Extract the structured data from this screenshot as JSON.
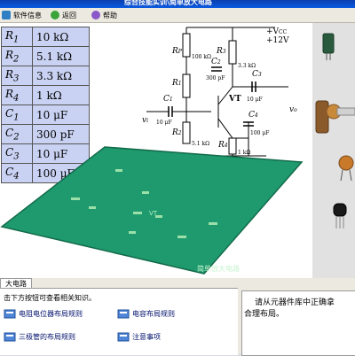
{
  "window": {
    "title": "综合技能实训\\简单放大电路"
  },
  "toolbar": {
    "info_label": "软件信息",
    "back_label": "返回",
    "help_label": "帮助"
  },
  "components": [
    {
      "symbol": "R",
      "sub": "1",
      "value": "10 kΩ"
    },
    {
      "symbol": "R",
      "sub": "2",
      "value": "5.1 kΩ"
    },
    {
      "symbol": "R",
      "sub": "3",
      "value": "3.3 kΩ"
    },
    {
      "symbol": "R",
      "sub": "4",
      "value": "1 kΩ"
    },
    {
      "symbol": "C",
      "sub": "1",
      "value": "10 μF"
    },
    {
      "symbol": "C",
      "sub": "2",
      "value": "300 pF"
    },
    {
      "symbol": "C",
      "sub": "3",
      "value": "10 μF"
    },
    {
      "symbol": "C",
      "sub": "4",
      "value": "100 μF"
    }
  ],
  "circuit": {
    "vcc": "+V",
    "vcc_sub": "CC",
    "supply": "+12V",
    "rp": "R",
    "rp_sub": "P",
    "rp_val": "100 kΩ",
    "r1": "R",
    "r1_sub": "1",
    "r2": "R",
    "r2_sub": "2",
    "r2_val": "5.1 kΩ",
    "r3": "R",
    "r3_sub": "3",
    "r3_val": "3.3 kΩ",
    "r4": "R",
    "r4_sub": "4",
    "r4_val": "1 kΩ",
    "c1": "C",
    "c1_sub": "1",
    "c1_val": "10 μF",
    "c2": "C",
    "c2_sub": "2",
    "c2_val": "300 pF",
    "c3": "C",
    "c3_sub": "3",
    "c3_val": "10 μF",
    "c4": "C",
    "c4_sub": "4",
    "c4_val": "100 μF",
    "transistor": "VT",
    "vi": "v",
    "vi_sub": "i",
    "vo": "v",
    "vo_sub": "o"
  },
  "board": {
    "label": "简单放大电路",
    "vt_label": "VT"
  },
  "bottom": {
    "tab_label": "大电路",
    "hint": "击下方按钮可查看相关知识。",
    "links": [
      "电阻电位器布局规则",
      "电容布局规则",
      "三极管的布局规则",
      "注意事项"
    ],
    "message_line1": "请从元器件库中正确拿",
    "message_line2": "合理布局。"
  },
  "colors": {
    "title_bg": "#0b4fd0",
    "table_cell": "#c9d2f2",
    "board": "#1e9a6e",
    "link": "#00106b"
  },
  "icons": [
    "app-logo-icon",
    "info-icon",
    "back-icon",
    "help-icon",
    "knowledge-link-icon"
  ]
}
